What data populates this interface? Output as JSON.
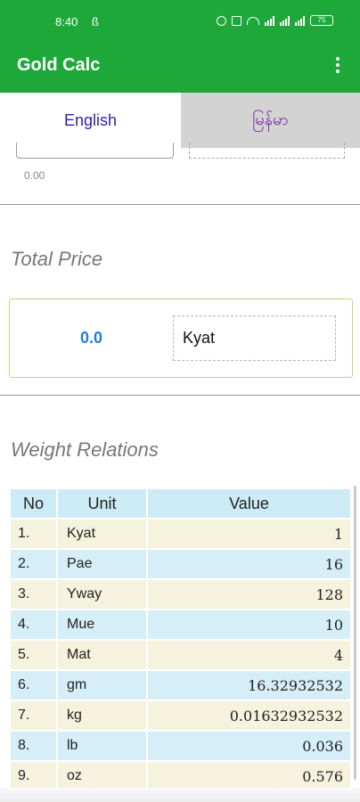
{
  "status_bar": {
    "time": "8:40",
    "glyph": "ß",
    "battery": "75"
  },
  "appbar": {
    "title": "Gold Calc"
  },
  "tabs": [
    {
      "label": "English",
      "active": true
    },
    {
      "label": "မြန်မာ",
      "active": false
    }
  ],
  "input_stub_value": "0.00",
  "total_price": {
    "title": "Total Price",
    "value": "0.0",
    "unit": "Kyat"
  },
  "weight_relations": {
    "title": "Weight Relations",
    "columns": [
      "No",
      "Unit",
      "Value"
    ],
    "rows": [
      {
        "no": "1.",
        "unit": "Kyat",
        "value": "1"
      },
      {
        "no": "2.",
        "unit": "Pae",
        "value": "16"
      },
      {
        "no": "3.",
        "unit": "Yway",
        "value": "128"
      },
      {
        "no": "4.",
        "unit": "Mue",
        "value": "10"
      },
      {
        "no": "5.",
        "unit": "Mat",
        "value": "4"
      },
      {
        "no": "6.",
        "unit": "gm",
        "value": "16.32932532"
      },
      {
        "no": "7.",
        "unit": "kg",
        "value": "0.01632932532"
      },
      {
        "no": "8.",
        "unit": "lb",
        "value": "0.036"
      },
      {
        "no": "9.",
        "unit": "oz",
        "value": "0.576"
      }
    ]
  },
  "colors": {
    "appbar": "#1ea83a",
    "active_tab_text": "#2b1fb0",
    "inactive_tab_text": "#7a1fa5",
    "price_value": "#1f7fd6"
  }
}
